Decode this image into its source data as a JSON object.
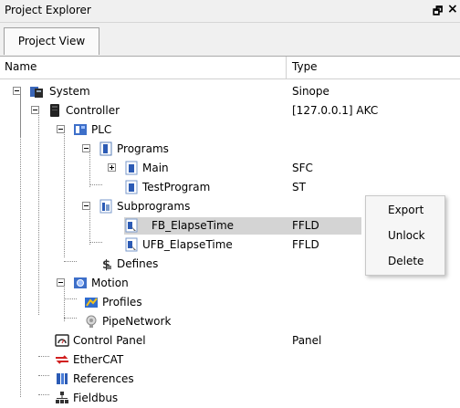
{
  "panel": {
    "title": "Project Explorer",
    "float_icon": "🗗",
    "close_icon": "×",
    "tab_label": "Project View"
  },
  "columns": {
    "name": "Name",
    "type": "Type"
  },
  "tree": [
    {
      "id": "system",
      "label": "System",
      "type": "Sinope",
      "icon": "system-icon",
      "expander": "minus"
    },
    {
      "id": "controller",
      "label": "Controller",
      "type": "[127.0.0.1] AKC",
      "icon": "controller-icon",
      "expander": "minus"
    },
    {
      "id": "plc",
      "label": "PLC",
      "type": "",
      "icon": "plc-icon",
      "expander": "minus"
    },
    {
      "id": "programs",
      "label": "Programs",
      "type": "",
      "icon": "programs-folder-icon",
      "expander": "minus"
    },
    {
      "id": "main",
      "label": "Main",
      "type": "SFC",
      "icon": "program-icon",
      "expander": "plus"
    },
    {
      "id": "testprogram",
      "label": "TestProgram",
      "type": "ST",
      "icon": "program-icon",
      "expander": "none"
    },
    {
      "id": "subprograms",
      "label": "Subprograms",
      "type": "",
      "icon": "subprograms-folder-icon",
      "expander": "minus"
    },
    {
      "id": "fb-elapsetime",
      "label": "FB_ElapseTime",
      "type": "FFLD",
      "icon": "function-block-icon",
      "expander": "none",
      "selected": true
    },
    {
      "id": "ufb-elapsetime",
      "label": "UFB_ElapseTime",
      "type": "FFLD",
      "icon": "function-block-icon",
      "expander": "none"
    },
    {
      "id": "defines",
      "label": "Defines",
      "type": "",
      "icon": "defines-icon",
      "expander": "none"
    },
    {
      "id": "motion",
      "label": "Motion",
      "type": "",
      "icon": "motion-icon",
      "expander": "minus"
    },
    {
      "id": "profiles",
      "label": "Profiles",
      "type": "",
      "icon": "profiles-icon",
      "expander": "none"
    },
    {
      "id": "pipenetwork",
      "label": "PipeNetwork",
      "type": "",
      "icon": "pipenetwork-icon",
      "expander": "none"
    },
    {
      "id": "control-panel",
      "label": "Control Panel",
      "type": "Panel",
      "icon": "control-panel-icon",
      "expander": "none"
    },
    {
      "id": "ethercat",
      "label": "EtherCAT",
      "type": "",
      "icon": "ethercat-icon",
      "expander": "none"
    },
    {
      "id": "references",
      "label": "References",
      "type": "",
      "icon": "references-icon",
      "expander": "none"
    },
    {
      "id": "fieldbus",
      "label": "Fieldbus",
      "type": "",
      "icon": "fieldbus-icon",
      "expander": "none"
    }
  ],
  "context_menu": {
    "items": [
      "Export",
      "Unlock",
      "Delete"
    ]
  }
}
